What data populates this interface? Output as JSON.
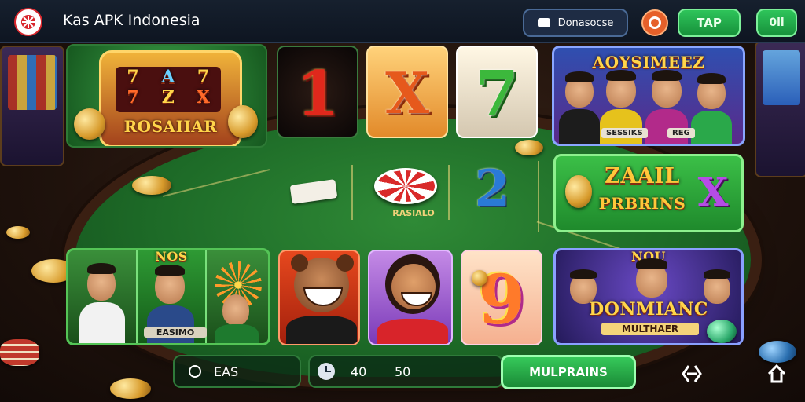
{
  "header": {
    "app_title": "Kas APK Indonesia",
    "account_button": "Donasocse",
    "tap_button": "TAP",
    "pause_button": "0ll"
  },
  "games": {
    "slot_machine": {
      "reels": [
        "7",
        "A",
        "7",
        "7",
        "Z",
        "X"
      ],
      "title": "ROSAIIAR"
    },
    "symbol_tiles": [
      "1",
      "X",
      "7"
    ],
    "team_banner": {
      "title": "AOYSIMEEZ",
      "sub_left": "SESSIKS",
      "sub_right": "REG"
    },
    "table_label": "RASIALO",
    "promo_tile": {
      "line1": "ZAAIL",
      "line2": "PRBRINS",
      "badge": "X"
    },
    "player_strip": {
      "top_label": "NOS",
      "bottom_label": "EASIMO"
    },
    "number_tile": "9",
    "dominance": {
      "top_label": "NOU",
      "line1": "DONMIANC",
      "line2": "MULTHAER"
    }
  },
  "bottom_bar": {
    "search_label": "EAS",
    "timer_left": "40",
    "timer_right": "50",
    "multiplayer_button": "MULPRAINS"
  },
  "colors": {
    "felt": "#1d6a27",
    "accent_green": "#2ec45a",
    "topbar": "#16202e",
    "gold": "#ffd54a"
  }
}
